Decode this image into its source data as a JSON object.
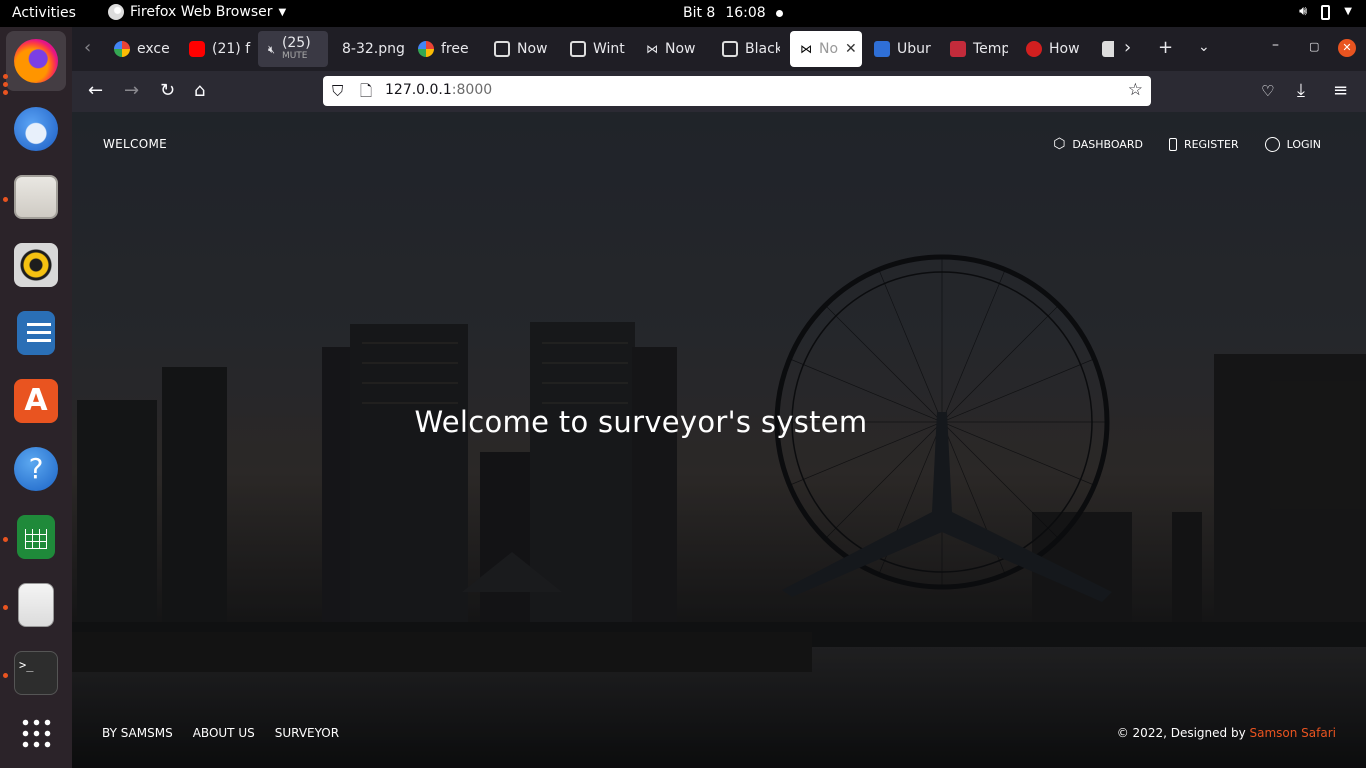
{
  "system_bar": {
    "activities": "Activities",
    "app_name": "Firefox Web Browser",
    "clock_day": "Bit 8",
    "clock_time": "16:08"
  },
  "dock": {
    "items": [
      {
        "name": "firefox",
        "active": true
      },
      {
        "name": "thunderbird"
      },
      {
        "name": "files"
      },
      {
        "name": "rhythmbox"
      },
      {
        "name": "libreoffice-writer"
      },
      {
        "name": "app-center"
      },
      {
        "name": "help"
      },
      {
        "name": "libreoffice-calc"
      },
      {
        "name": "text-editor"
      },
      {
        "name": "terminal"
      },
      {
        "name": "show-apps"
      }
    ],
    "terminal_glyph": ">_"
  },
  "tabs": [
    {
      "title": "exce",
      "favicon": "google"
    },
    {
      "title": "(21) f",
      "favicon": "youtube"
    },
    {
      "title": "(25)",
      "subtitle": "MUTE",
      "favicon": "speaker-muted"
    },
    {
      "title": "8-32.png",
      "favicon": "none"
    },
    {
      "title": "free",
      "favicon": "google"
    },
    {
      "title": "Now",
      "favicon": "notion"
    },
    {
      "title": "Wint",
      "favicon": "notion"
    },
    {
      "title": "Now",
      "favicon": "bow"
    },
    {
      "title": "Black",
      "favicon": "notion"
    },
    {
      "title": "No",
      "favicon": "bow",
      "selected": true
    },
    {
      "title": "Ubur",
      "favicon": "ubuntu"
    },
    {
      "title": "Temp",
      "favicon": "red"
    },
    {
      "title": "How",
      "favicon": "red-circle"
    },
    {
      "title": "",
      "favicon": "generic"
    }
  ],
  "address_bar": {
    "host": "127.0.0.1",
    "port": ":8000"
  },
  "page": {
    "brand": "WELCOME",
    "nav": [
      {
        "label": "DASHBOARD"
      },
      {
        "label": "REGISTER"
      },
      {
        "label": "LOGIN"
      }
    ],
    "hero_title": "Welcome to surveyor's system",
    "footer_links": [
      "BY SAMSMS",
      "ABOUT US",
      "SURVEYOR"
    ],
    "copyright_prefix": "© 2022, Designed by ",
    "copyright_author": "Samson Safari"
  },
  "colors": {
    "accent": "#e95420",
    "topbar": "#000000",
    "dock": "#2b2329",
    "tabbar": "#1f1e25",
    "navbar": "#2b2a33"
  }
}
